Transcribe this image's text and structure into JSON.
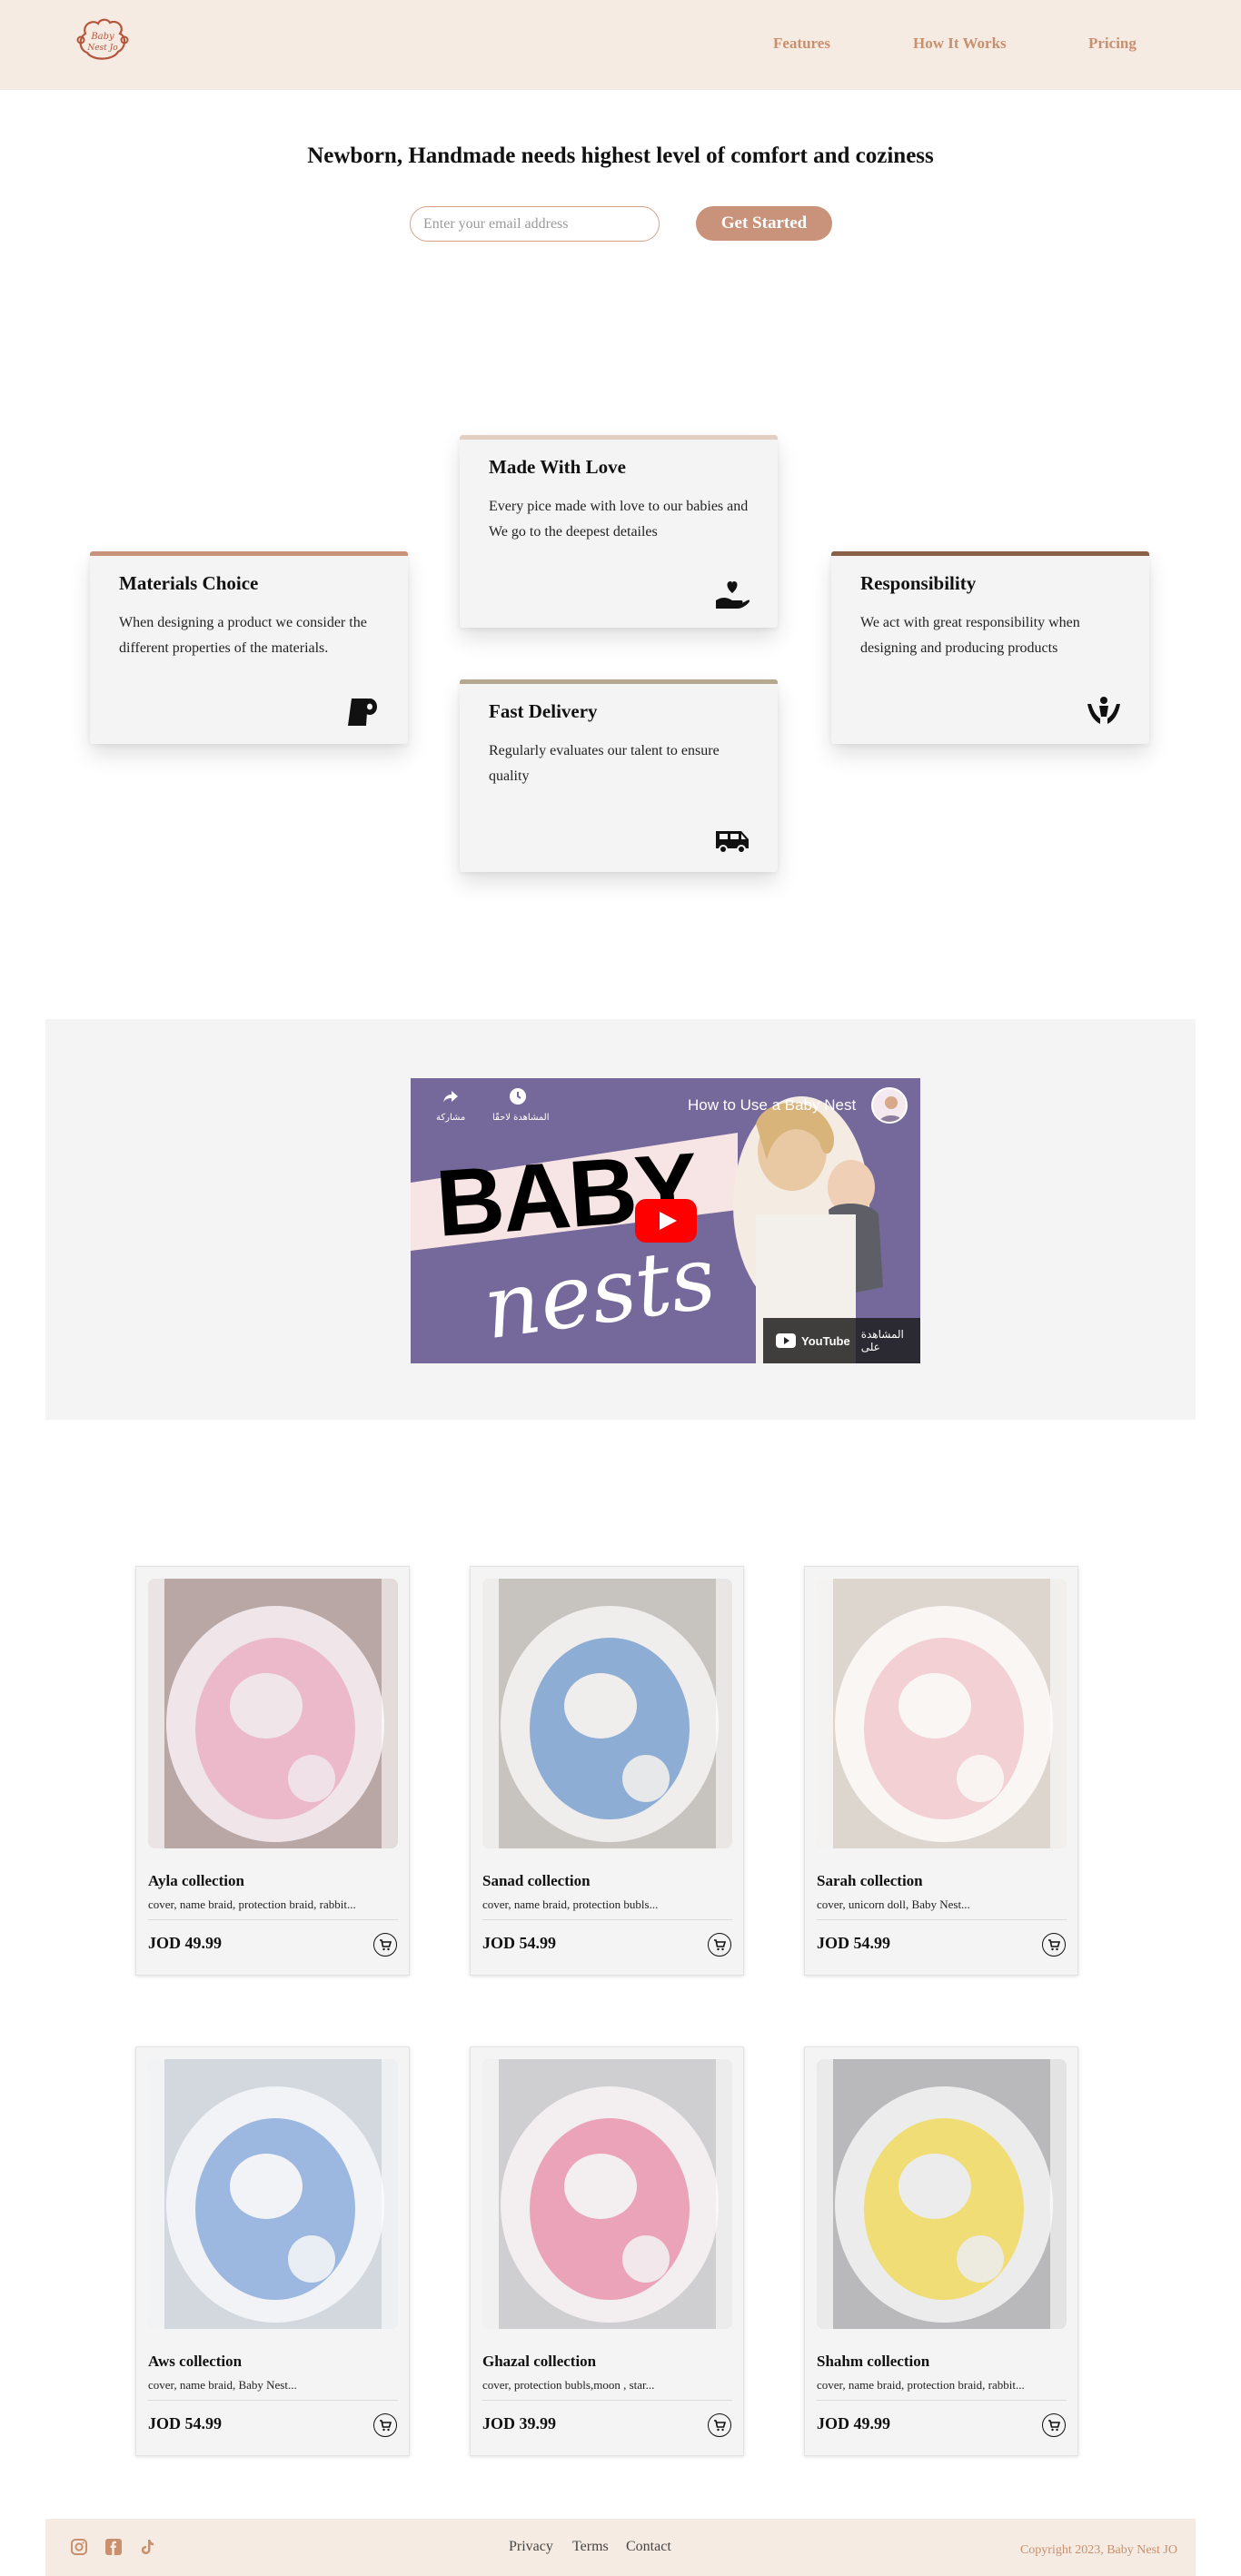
{
  "header": {
    "logo_text_line1": "Baby",
    "logo_text_line2": "Nest Jo",
    "nav": [
      "Features",
      "How It Works",
      "Pricing"
    ]
  },
  "hero": {
    "title": "Newborn, Handmade needs highest level of comfort and coziness",
    "email_placeholder": "Enter your email address",
    "cta_label": "Get Started"
  },
  "features": [
    {
      "title": "Materials Choice",
      "text": "When designing a product we consider the different properties of the materials.",
      "icon": "toilet-paper-icon",
      "accent": "#c9927a"
    },
    {
      "title": "Made With Love",
      "text": "Every pice made with love to our babies and We go to the deepest detailes",
      "icon": "hand-heart-icon",
      "accent": "#e2cfc2"
    },
    {
      "title": "Fast Delivery",
      "text": "Regularly evaluates our talent to ensure quality",
      "icon": "van-icon",
      "accent": "#b5a88e"
    },
    {
      "title": "Responsibility",
      "text": "We act with great responsibility when designing and producing products",
      "icon": "hands-child-icon",
      "accent": "#8a6047"
    }
  ],
  "video": {
    "title": "How to Use a Baby Nest",
    "share_label": "مشاركة",
    "watch_later_label": "المشاهدة لاحقًا",
    "watch_on_label": "المشاهدة على",
    "youtube_label": "YouTube",
    "big_word_1": "BABY",
    "big_word_2": "nests"
  },
  "products": [
    {
      "name": "Ayla collection",
      "desc": "cover, name braid, protection braid, rabbit...",
      "price": "JOD 49.99",
      "palette": [
        "#b9a7a6",
        "#e9a9bd",
        "#f0e6ea"
      ]
    },
    {
      "name": "Sanad collection",
      "desc": "cover, name braid, protection bubls...",
      "price": "JOD 54.99",
      "palette": [
        "#c7c4c0",
        "#6e97cc",
        "#f0eeec"
      ]
    },
    {
      "name": "Sarah collection",
      "desc": "cover, unicorn doll, Baby Nest...",
      "price": "JOD 54.99",
      "palette": [
        "#dcd6cf",
        "#efc3c9",
        "#faf6f4"
      ]
    },
    {
      "name": "Aws collection",
      "desc": "cover, name braid, Baby Nest...",
      "price": "JOD 54.99",
      "palette": [
        "#d3d7de",
        "#7fa3d8",
        "#f2f3f6"
      ]
    },
    {
      "name": "Ghazal collection",
      "desc": "cover, protection bubls,moon , star...",
      "price": "JOD 39.99",
      "palette": [
        "#cfcfd2",
        "#e88aa8",
        "#f3eef0"
      ]
    },
    {
      "name": "Shahm collection",
      "desc": "cover, name braid, protection braid, rabbit...",
      "price": "JOD 49.99",
      "palette": [
        "#b9b9bc",
        "#f2d84f",
        "#ececec"
      ]
    }
  ],
  "footer": {
    "links": [
      "Privacy",
      "Terms",
      "Contact"
    ],
    "copyright": "Copyright 2023, Baby Nest JO",
    "social": [
      "instagram-icon",
      "facebook-icon",
      "tiktok-icon"
    ]
  },
  "colors": {
    "brand": "#c9927a",
    "header_bg": "#f5ebe2",
    "nav_text": "#c8906e",
    "card_bg": "#f4f4f4"
  }
}
